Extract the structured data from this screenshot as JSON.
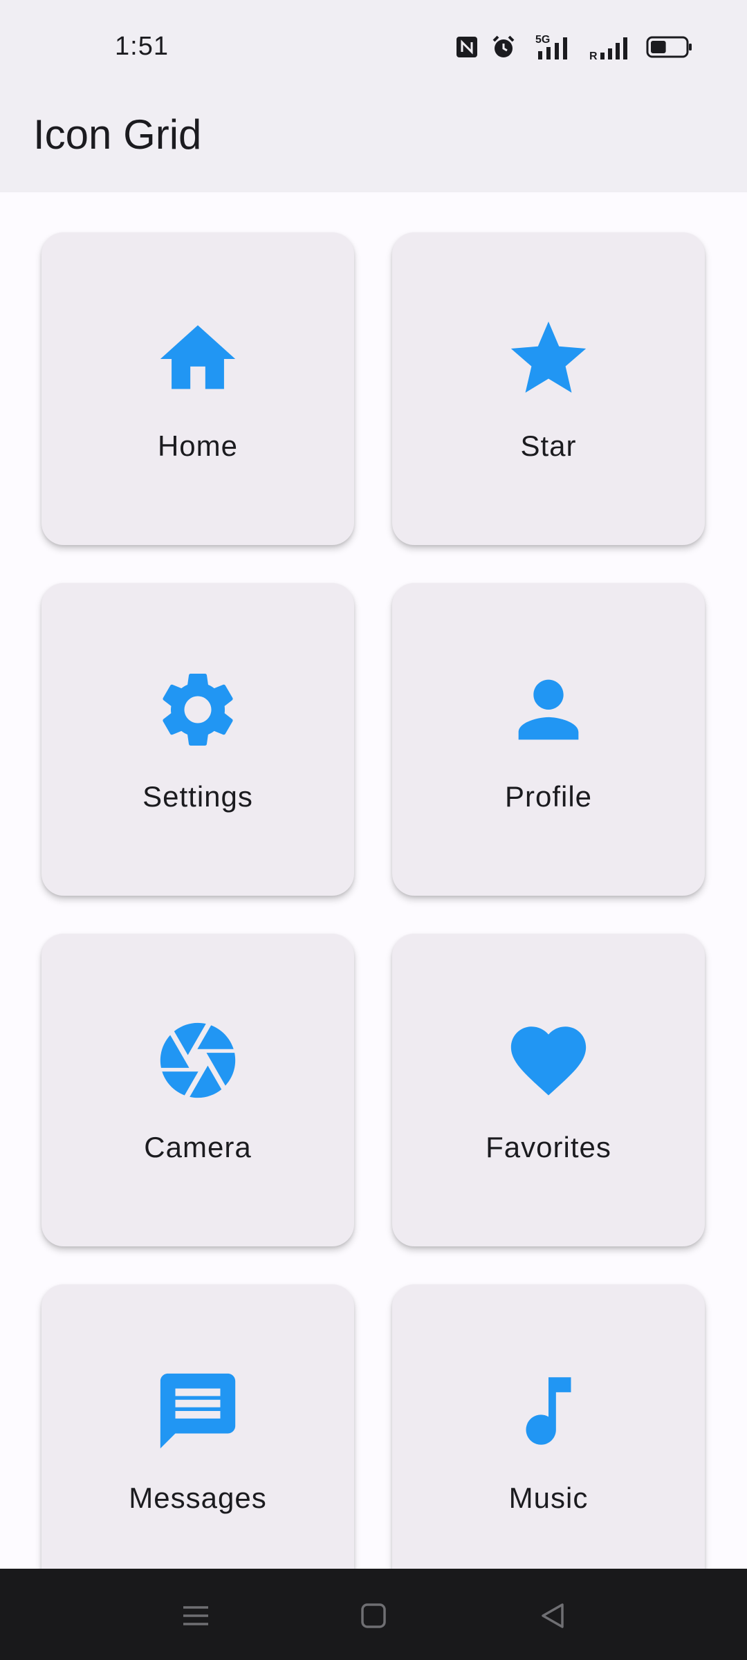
{
  "status_bar": {
    "time": "1:51",
    "network_label": "5G",
    "roaming_label": "R",
    "icons": [
      "nfc-icon",
      "alarm-icon",
      "signal-5g-icon",
      "signal-roaming-icon",
      "battery-icon"
    ],
    "battery_level": 0.45
  },
  "app_bar": {
    "title": "Icon Grid"
  },
  "grid": {
    "items": [
      {
        "label": "Home",
        "icon": "home-icon"
      },
      {
        "label": "Star",
        "icon": "star-icon"
      },
      {
        "label": "Settings",
        "icon": "settings-icon"
      },
      {
        "label": "Profile",
        "icon": "profile-icon"
      },
      {
        "label": "Camera",
        "icon": "camera-icon"
      },
      {
        "label": "Favorites",
        "icon": "heart-icon"
      },
      {
        "label": "Messages",
        "icon": "message-icon"
      },
      {
        "label": "Music",
        "icon": "music-icon"
      }
    ]
  },
  "nav_bar": {
    "buttons": [
      "menu-icon",
      "home-square-icon",
      "back-icon"
    ]
  },
  "colors": {
    "accent": "#2196f3",
    "card": "#efebf1",
    "background": "#fdfbff",
    "bar": "#f0eef3",
    "nav": "#19191b"
  }
}
